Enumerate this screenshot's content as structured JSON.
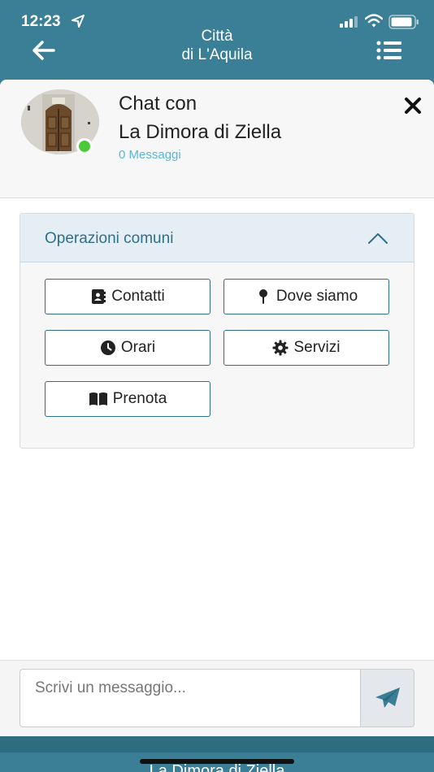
{
  "status_bar": {
    "time": "12:23",
    "icons": [
      "location-arrow-icon",
      "signal-icon",
      "wifi-icon",
      "battery-icon"
    ]
  },
  "header": {
    "title_line1": "Città",
    "title_line2": "di L'Aquila",
    "back_icon": "arrow-left-icon",
    "menu_icon": "list-menu-icon"
  },
  "chat": {
    "label": "Chat con",
    "name": "La Dimora di Ziella",
    "message_count": "0 Messaggi",
    "online_color": "#4cca3b",
    "close_icon": "close-x-icon"
  },
  "operations": {
    "title": "Operazioni comuni",
    "buttons": [
      {
        "label": "Contatti",
        "icon": "address-card-icon"
      },
      {
        "label": "Dove siamo",
        "icon": "map-pin-icon"
      },
      {
        "label": "Orari",
        "icon": "clock-icon"
      },
      {
        "label": "Servizi",
        "icon": "gear-icon"
      },
      {
        "label": "Prenota",
        "icon": "book-open-icon"
      }
    ]
  },
  "composer": {
    "placeholder": "Scrivi un messaggio...",
    "send_icon": "paper-plane-icon"
  },
  "background_page": {
    "peek_title": "La Dimora di Ziella"
  },
  "colors": {
    "header_bg": "#3a7f95",
    "accent": "#2f7088",
    "link": "#5bb5d9"
  }
}
